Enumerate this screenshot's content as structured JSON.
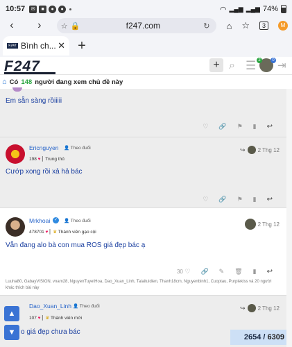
{
  "status_bar": {
    "time": "10:57",
    "battery": "74%"
  },
  "browser": {
    "url": "f247.com",
    "tab_title": "Bình ch...",
    "tab_count": "3"
  },
  "site": {
    "logo": "F247",
    "notif_count": "2",
    "msg_count": "0"
  },
  "viewing": {
    "prefix": "Có",
    "count": "148",
    "suffix": "người đang xem chủ đề này"
  },
  "post0": {
    "text": "Em sẵn sàng rồiiiii"
  },
  "post1": {
    "username": "Ericnguyen",
    "follow": "Theo đuổi",
    "post_count": "198",
    "rank": "Trung thủ",
    "time": "2 Thg 12",
    "text": "Cướp xong rồi xả hả bác"
  },
  "post2": {
    "username": "Mrkhoai",
    "follow": "Theo đuổi",
    "post_count": "478701",
    "rank": "Thành viên gạo cội",
    "time": "2 Thg 12",
    "text": "Vẫn đang alo bà con mua ROS giá đẹp bác ạ",
    "likes": "30",
    "likers": "Luuha80, GabayVISION, vnam28, NguyenTuyetHoa, Dao_Xuan_Linh, Taiaituidien, Thanh18cm, Nguyenbinh1, Cuoptau, Purplekiss và 20 người khác thích bài này"
  },
  "post3": {
    "username": "Dao_Xuan_Linh",
    "follow": "Theo đuổi",
    "post_count": "107",
    "rank": "Thành viên mới",
    "time": "2 Thg 12",
    "text": "o giá đẹp chưa bác"
  },
  "progress": {
    "current": "2654",
    "total": "6309"
  }
}
